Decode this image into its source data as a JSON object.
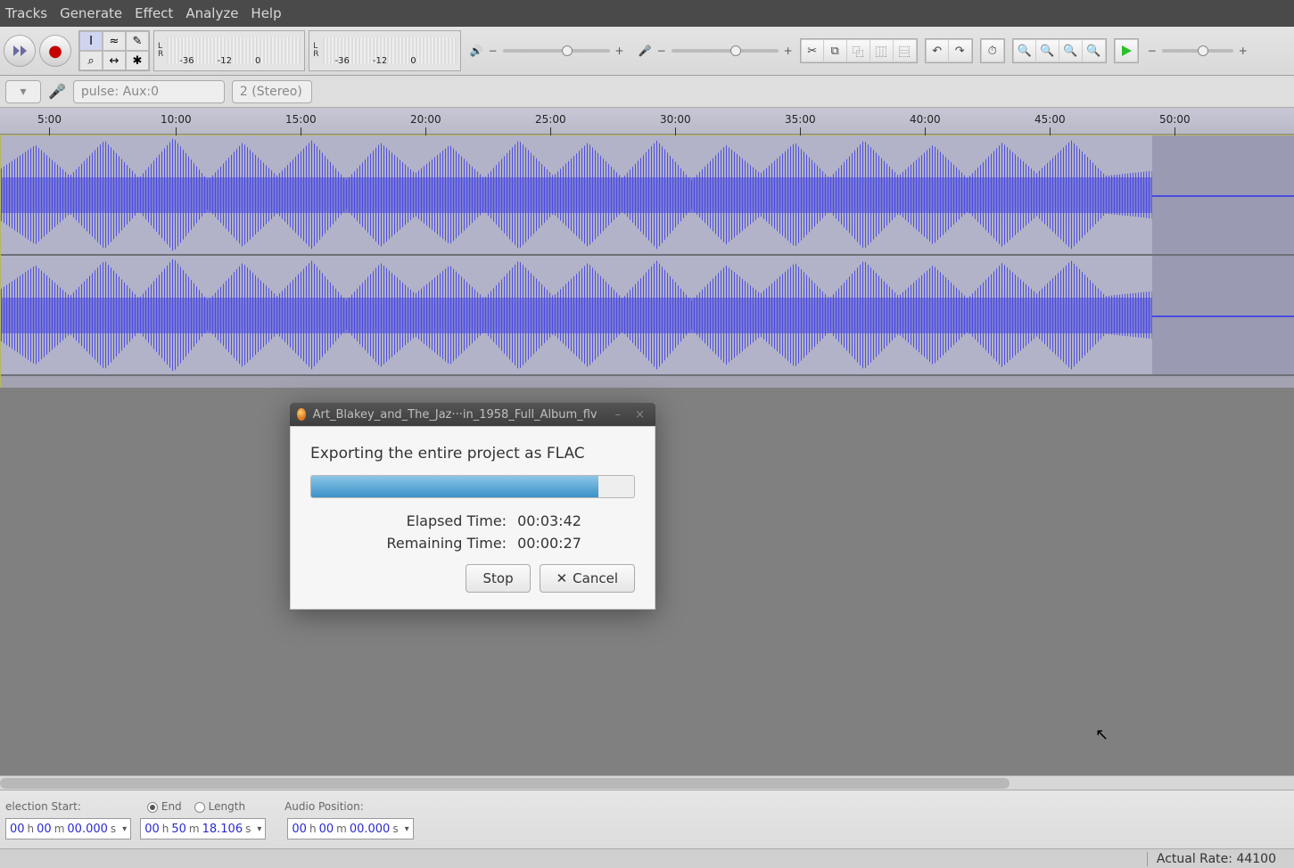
{
  "menu": {
    "items": [
      "Tracks",
      "Generate",
      "Effect",
      "Analyze",
      "Help"
    ]
  },
  "tool_grid": [
    "I",
    "≈",
    "✎",
    "⌕",
    "↔",
    "✱"
  ],
  "meters": {
    "labels": [
      "L",
      "R"
    ],
    "ticks": [
      "-36",
      "-12",
      "0"
    ]
  },
  "sliders": {
    "volume_icon": "🔊",
    "mic_icon": "🎤",
    "minus": "−",
    "plus": "+"
  },
  "edit_strip": [
    "✂",
    "⧉",
    "⿻",
    "⿲",
    "⿳"
  ],
  "undo_strip": [
    "↶",
    "↷"
  ],
  "device_row": {
    "mic_device": "pulse: Aux:0",
    "channels": "2 (Stereo)"
  },
  "timeline_ticks": [
    "5:00",
    "10:00",
    "15:00",
    "20:00",
    "25:00",
    "30:00",
    "35:00",
    "40:00",
    "45:00",
    "50:00"
  ],
  "dialog": {
    "title": "Art_Blakey_and_The_Jaz···in_1958_Full_Album_flv",
    "msg": "Exporting the entire project as FLAC",
    "progress_pct": 89,
    "elapsed_label": "Elapsed Time:",
    "elapsed_val": "00:03:42",
    "remaining_label": "Remaining Time:",
    "remaining_val": "00:00:27",
    "stop": "Stop",
    "cancel": "Cancel"
  },
  "selection": {
    "start_label": "election Start:",
    "end_label": "End",
    "length_label": "Length",
    "audio_pos_label": "Audio Position:",
    "sel_start": {
      "h": "00",
      "m": "00",
      "s": "00.000"
    },
    "sel_end": {
      "h": "00",
      "m": "50",
      "s": "18.106"
    },
    "audio_pos": {
      "h": "00",
      "m": "00",
      "s": "00.000"
    }
  },
  "status": {
    "actual_rate_label": "Actual Rate:",
    "actual_rate": "44100"
  }
}
